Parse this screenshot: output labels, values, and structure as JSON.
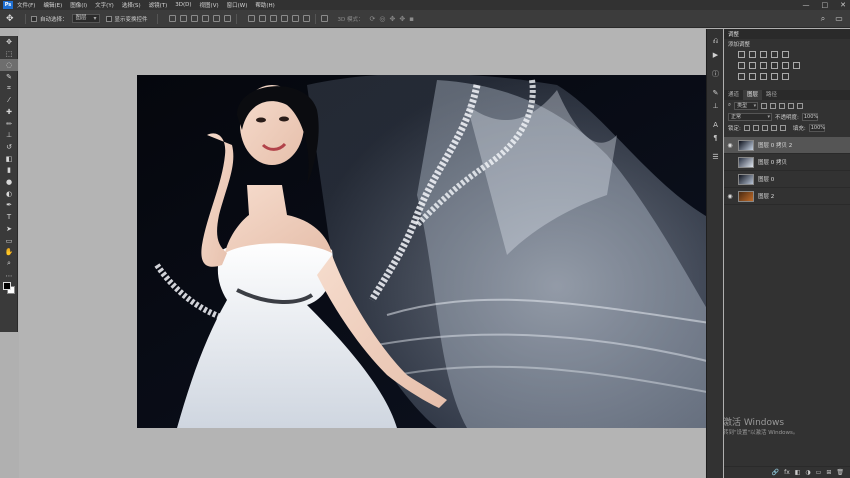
{
  "app": {
    "logo": "Ps"
  },
  "menu": [
    "文件(F)",
    "编辑(E)",
    "图像(I)",
    "文字(Y)",
    "选择(S)",
    "滤镜(T)",
    "3D(D)",
    "视图(V)",
    "窗口(W)",
    "帮助(H)"
  ],
  "window_controls": {
    "minimize": "—",
    "restore": "□",
    "close": "✕"
  },
  "options_bar": {
    "auto_select_label": "自动选择：",
    "auto_select_value": "图层",
    "show_transform_label": "显示变换控件",
    "mode_3d_label": "3D 模式："
  },
  "tools": [
    {
      "name": "move-tool",
      "glyph": "✥"
    },
    {
      "name": "marquee-tool",
      "glyph": "⬚"
    },
    {
      "name": "lasso-tool",
      "glyph": "◌"
    },
    {
      "name": "quick-select-tool",
      "glyph": "✎"
    },
    {
      "name": "crop-tool",
      "glyph": "⌗"
    },
    {
      "name": "eyedropper-tool",
      "glyph": "⁄"
    },
    {
      "name": "healing-brush-tool",
      "glyph": "✚"
    },
    {
      "name": "brush-tool",
      "glyph": "✏"
    },
    {
      "name": "clone-stamp-tool",
      "glyph": "⊥"
    },
    {
      "name": "history-brush-tool",
      "glyph": "↺"
    },
    {
      "name": "eraser-tool",
      "glyph": "◧"
    },
    {
      "name": "gradient-tool",
      "glyph": "▮"
    },
    {
      "name": "blur-tool",
      "glyph": "●"
    },
    {
      "name": "dodge-tool",
      "glyph": "◐"
    },
    {
      "name": "pen-tool",
      "glyph": "✒"
    },
    {
      "name": "type-tool",
      "glyph": "T"
    },
    {
      "name": "path-select-tool",
      "glyph": "➤"
    },
    {
      "name": "shape-tool",
      "glyph": "▭"
    },
    {
      "name": "hand-tool",
      "glyph": "✋"
    },
    {
      "name": "zoom-tool",
      "glyph": "⌕"
    },
    {
      "name": "more-tools",
      "glyph": "⋯"
    }
  ],
  "adjustments_panel": {
    "title": "调整",
    "subtitle": "添加调整"
  },
  "layers_panel": {
    "tabs": [
      "通道",
      "图层",
      "路径"
    ],
    "active_tab": "图层",
    "filter_value": "类型",
    "blend_mode": "正常",
    "opacity_label": "不透明度:",
    "opacity_value": "100%",
    "lock_label": "锁定:",
    "fill_label": "填充:",
    "fill_value": "100%",
    "layers": [
      {
        "name": "图层 0 拷贝 2",
        "visible": true,
        "selected": true
      },
      {
        "name": "图层 0 拷贝",
        "visible": false,
        "selected": false
      },
      {
        "name": "图层 0",
        "visible": false,
        "selected": false
      },
      {
        "name": "图层 2",
        "visible": true,
        "selected": false
      }
    ]
  },
  "footer_icons": [
    "🔗",
    "fx",
    "◧",
    "◑",
    "▭",
    "⊞",
    "🗑"
  ],
  "activation_watermark": {
    "title": "激活 Windows",
    "subtitle": "转到\"设置\"以激活 Windows。"
  }
}
